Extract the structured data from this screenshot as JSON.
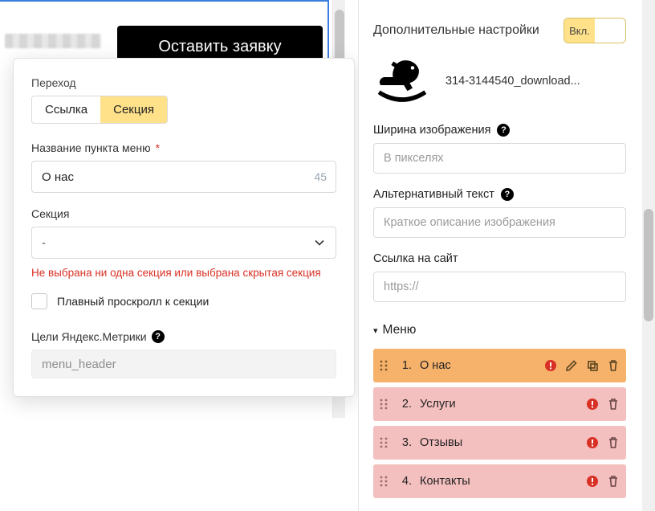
{
  "preview": {
    "cta_label": "Оставить заявку"
  },
  "popup": {
    "transition_label": "Переход",
    "tabs": {
      "link": "Ссылка",
      "section": "Секция"
    },
    "name_label": "Название пункта меню",
    "name_value": "О нас",
    "name_counter": "45",
    "section_label": "Секция",
    "section_value": "-",
    "section_error": "Не выбрана ни одна секция или выбрана скрытая секция",
    "smooth_label": "Плавный проскролл к секции",
    "metrika_label": "Цели Яндекс.Метрики",
    "metrika_value": "menu_header"
  },
  "right": {
    "title": "Дополнительные настройки",
    "toggle_on": "Вкл.",
    "logo_filename": "314-3144540_download...",
    "width_label": "Ширина изображения",
    "width_placeholder": "В пикселях",
    "alt_label": "Альтернативный текст",
    "alt_placeholder": "Краткое описание изображения",
    "link_label": "Ссылка на сайт",
    "link_placeholder": "https://",
    "menu_title": "Меню",
    "menu_items": [
      {
        "idx": "1.",
        "label": "О нас"
      },
      {
        "idx": "2.",
        "label": "Услуги"
      },
      {
        "idx": "3.",
        "label": "Отзывы"
      },
      {
        "idx": "4.",
        "label": "Контакты"
      }
    ]
  }
}
